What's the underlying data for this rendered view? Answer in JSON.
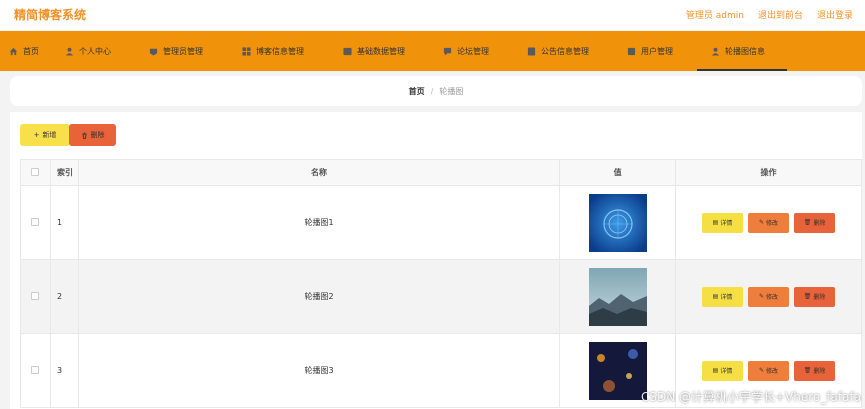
{
  "header": {
    "brand": "精简博客系统",
    "admin_label": "管理员 admin",
    "back_link": "退出到前台",
    "logout_link": "退出登录"
  },
  "nav": {
    "items": [
      {
        "label": "首页",
        "icon": "home-icon"
      },
      {
        "label": "个人中心",
        "icon": "user-icon"
      },
      {
        "label": "管理员管理",
        "icon": "admin-icon"
      },
      {
        "label": "博客信息管理",
        "icon": "grid-icon"
      },
      {
        "label": "基础数据管理",
        "icon": "database-icon"
      },
      {
        "label": "论坛管理",
        "icon": "forum-icon"
      },
      {
        "label": "公告信息管理",
        "icon": "notice-icon"
      },
      {
        "label": "用户管理",
        "icon": "users-icon"
      },
      {
        "label": "轮播图信息",
        "icon": "carousel-icon"
      }
    ],
    "active_index": 8
  },
  "breadcrumb": {
    "home": "首页",
    "separator": "/",
    "current": "轮播图"
  },
  "toolbar": {
    "add_label": "新增",
    "delete_label": "删除"
  },
  "table": {
    "headers": {
      "index": "索引",
      "name": "名称",
      "value": "值",
      "actions": "操作"
    },
    "rows": [
      {
        "index": "1",
        "name": "轮播图1"
      },
      {
        "index": "2",
        "name": "轮播图2"
      },
      {
        "index": "3",
        "name": "轮播图3"
      }
    ],
    "actions": {
      "detail": "详情",
      "edit": "修改",
      "delete": "删除"
    }
  },
  "watermark": "CSDN @计算机小宇学长+Vhero_fafafa",
  "colors": {
    "brand": "#f0932b",
    "nav_bg": "#f0930b",
    "add_btn": "#f7e04a",
    "delete_btn": "#e8623a",
    "edit_btn": "#ef7d3c"
  }
}
